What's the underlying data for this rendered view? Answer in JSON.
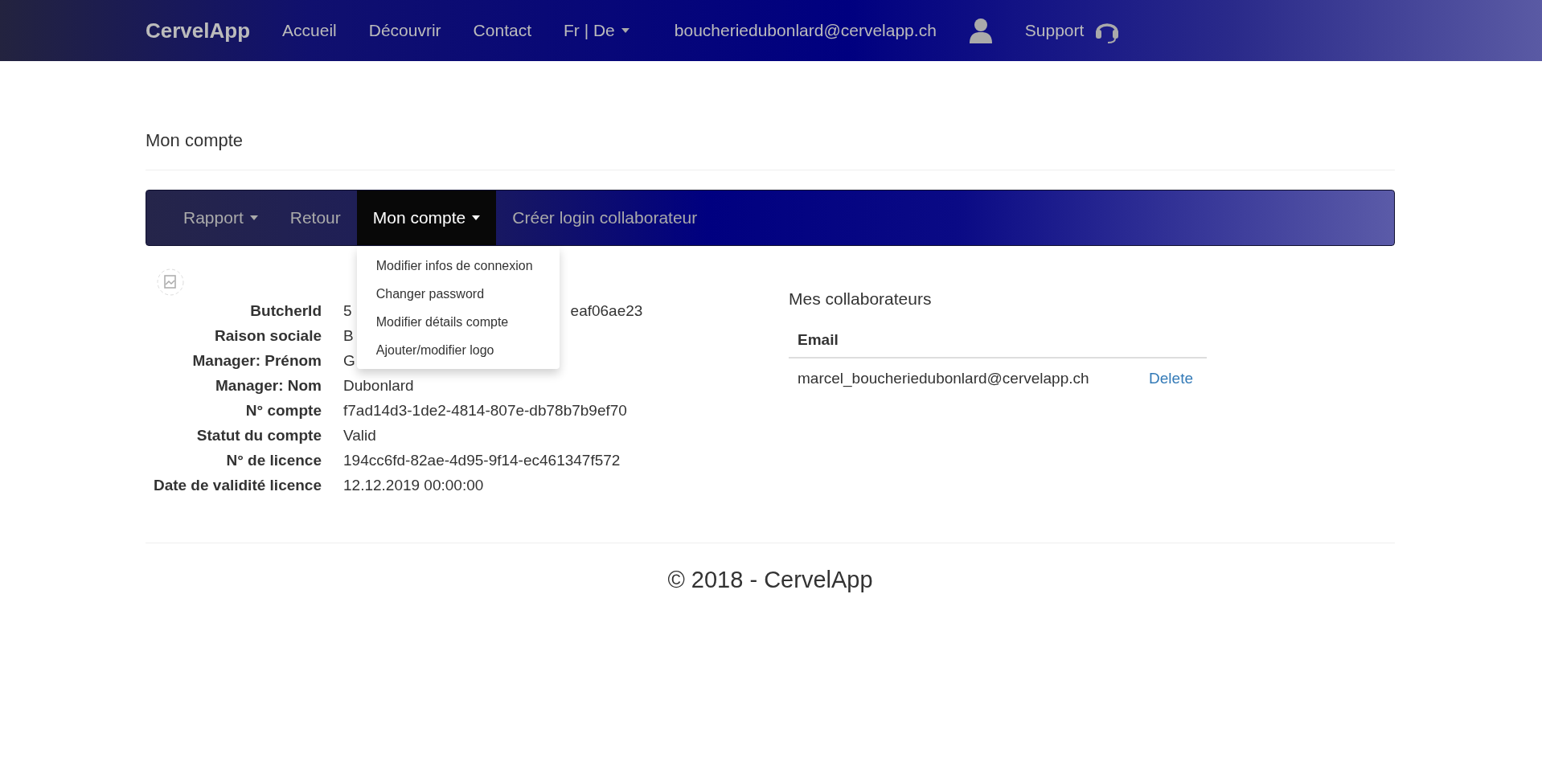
{
  "navbar": {
    "brand": "CervelApp",
    "links": [
      {
        "label": "Accueil",
        "caret": false
      },
      {
        "label": "Découvrir",
        "caret": false
      },
      {
        "label": "Contact",
        "caret": false
      },
      {
        "label": "Fr | De",
        "caret": true
      }
    ],
    "email": "boucheriedubonlard@cervelapp.ch",
    "support": "Support"
  },
  "page_title": "Mon compte",
  "subnav": [
    {
      "label": "Rapport",
      "caret": true,
      "selected": false
    },
    {
      "label": "Retour",
      "caret": false,
      "selected": false
    },
    {
      "label": "Mon compte",
      "caret": true,
      "selected": true,
      "menu": [
        "Modifier infos de connexion",
        "Changer password",
        "Modifier détails compte",
        "Ajouter/modifier logo"
      ]
    },
    {
      "label": "Créer login collaborateur",
      "caret": false,
      "selected": false
    }
  ],
  "details": [
    {
      "label": "ButcherId",
      "value": "5",
      "value_tail": "eaf06ae23"
    },
    {
      "label": "Raison sociale",
      "value": "B"
    },
    {
      "label": "Manager: Prénom",
      "value": "G"
    },
    {
      "label": "Manager: Nom",
      "value": "Dubonlard"
    },
    {
      "label": "N° compte",
      "value": "f7ad14d3-1de2-4814-807e-db78b7b9ef70"
    },
    {
      "label": "Statut du compte",
      "value": "Valid"
    },
    {
      "label": "N° de licence",
      "value": "194cc6fd-82ae-4d95-9f14-ec461347f572"
    },
    {
      "label": "Date de validité licence",
      "value": "12.12.2019 00:00:00"
    }
  ],
  "collaborators": {
    "title": "Mes collaborateurs",
    "columns": [
      "Email"
    ],
    "rows": [
      {
        "email": "marcel_boucheriedubonlard@cervelapp.ch",
        "action": "Delete"
      }
    ]
  },
  "footer": "© 2018 - CervelApp"
}
